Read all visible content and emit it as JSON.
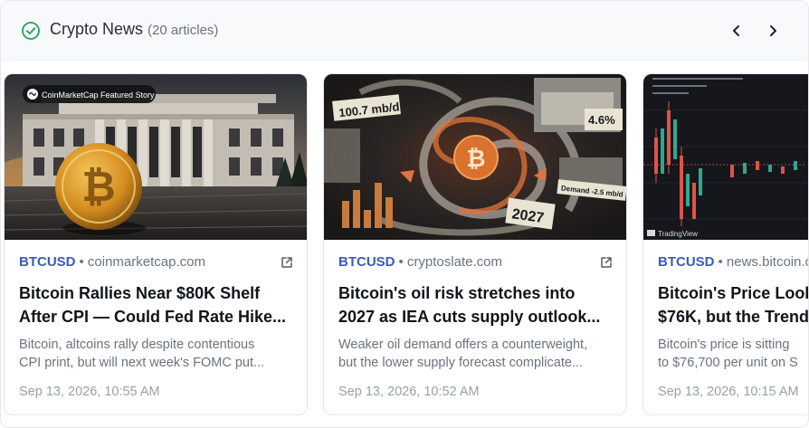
{
  "header": {
    "title": "Crypto News",
    "count": "(20 articles)"
  },
  "colors": {
    "ticker": "#3b5bb5",
    "check": "#22a35a",
    "headline": "#111418"
  },
  "icons": {
    "status": "check-circle-icon",
    "prev": "chevron-left-icon",
    "next": "chevron-right-icon",
    "external": "external-link-icon"
  },
  "cards": [
    {
      "badge": "CoinMarketCap Featured Story",
      "ticker": "BTCUSD",
      "source": "• coinmarketcap.com",
      "headline_line1": "Bitcoin Rallies Near $80K Shelf",
      "headline_line2": "After CPI — Could Fed Rate Hike...",
      "summary_line1": "Bitcoin, altcoins rally despite contentious",
      "summary_line2": "CPI print, but will next week's FOMC put...",
      "date": "Sep 13, 2026, 10:55 AM"
    },
    {
      "img_label_1": "100.7 mb/d",
      "img_label_2": "4.6%",
      "img_label_3": "Demand -2.5 mb/d",
      "img_label_4": "2027",
      "ticker": "BTCUSD",
      "source": "• cryptoslate.com",
      "headline_line1": "Bitcoin's oil risk stretches into",
      "headline_line2": "2027 as IEA cuts supply outlook...",
      "summary_line1": "Weaker oil demand offers a counterweight,",
      "summary_line2": "but the lower supply forecast complicate...",
      "date": "Sep 13, 2026, 10:52 AM"
    },
    {
      "img_label": "TradingView",
      "ticker": "BTCUSD",
      "source": "• news.bitcoin.com",
      "headline_line1": "Bitcoin's Price Looks",
      "headline_line2": "$76K, but the Trend",
      "summary_line1": "Bitcoin's price is sitting",
      "summary_line2": "to $76,700 per unit on S",
      "date": "Sep 13, 2026, 10:15 AM"
    }
  ]
}
